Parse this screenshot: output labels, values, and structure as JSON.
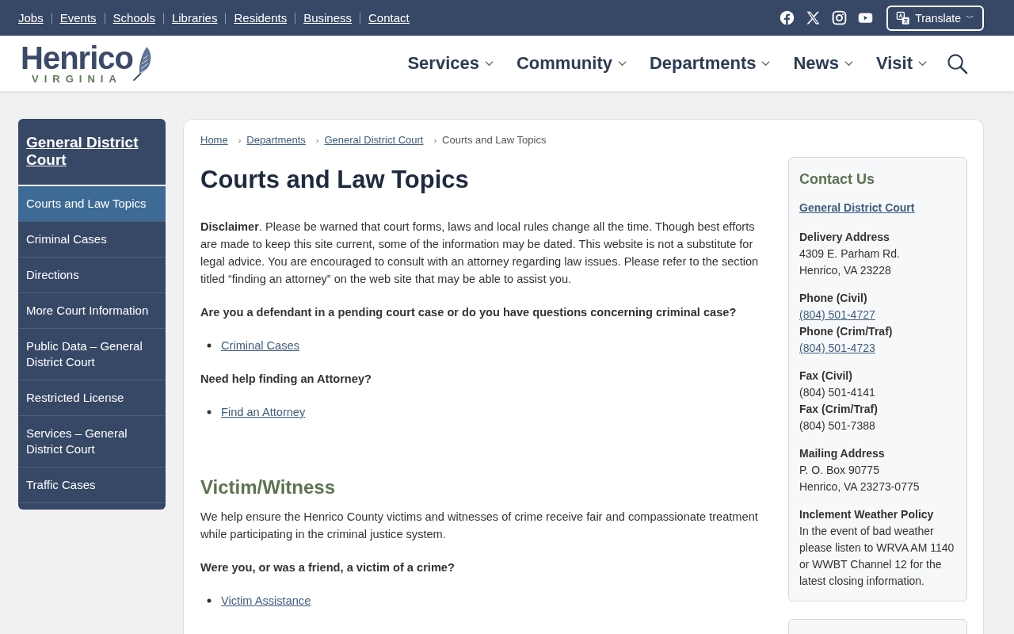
{
  "top_links": [
    "Jobs",
    "Events",
    "Schools",
    "Libraries",
    "Residents",
    "Business",
    "Contact"
  ],
  "social": [
    {
      "kind": "facebook"
    },
    {
      "kind": "x"
    },
    {
      "kind": "instagram"
    },
    {
      "kind": "youtube"
    }
  ],
  "translate": {
    "label": "Translate",
    "caret": "﹀"
  },
  "logo": {
    "name": "Henrico",
    "sub": "VIRGINIA"
  },
  "nav": [
    {
      "label": "Services"
    },
    {
      "label": "Community"
    },
    {
      "label": "Departments"
    },
    {
      "label": "News"
    },
    {
      "label": "Visit"
    }
  ],
  "sidebar": {
    "title": "General District Court",
    "items": [
      {
        "label": "Courts and Law Topics",
        "selected": true
      },
      {
        "label": "Criminal Cases",
        "selected": false
      },
      {
        "label": "Directions",
        "selected": false
      },
      {
        "label": "More Court Information",
        "selected": false
      },
      {
        "label": "Public Data – General District Court",
        "selected": false
      },
      {
        "label": "Restricted License",
        "selected": false
      },
      {
        "label": "Services – General District Court",
        "selected": false
      },
      {
        "label": "Traffic Cases",
        "selected": false
      }
    ]
  },
  "breadcrumb": [
    {
      "label": "Home",
      "link": true
    },
    {
      "label": "Departments",
      "link": true,
      "sep": "›"
    },
    {
      "label": "General District Court",
      "link": true,
      "sep": "›"
    },
    {
      "label": "Courts and Law Topics",
      "link": false,
      "sep": "›"
    }
  ],
  "title": "Courts and Law Topics",
  "content": [
    {
      "kind": "paragraph",
      "text": "**Disclaimer**. Please be warned that court forms, laws and local rules change all the time. Though best efforts are made to keep this site current, some of the information may be dated. This website is not a substitute for legal advice. You are encouraged to consult with an attorney regarding law issues. Please refer to the section titled “finding an attorney” on the web site that may be able to assist you."
    },
    {
      "kind": "question",
      "text": "Are you a defendant in a pending court case or do you have questions concerning criminal case?"
    },
    {
      "kind": "links",
      "items": [
        "Criminal Cases"
      ]
    },
    {
      "kind": "question",
      "text": "Need help finding an Attorney?"
    },
    {
      "kind": "links",
      "items": [
        "Find an Attorney"
      ]
    },
    {
      "kind": "heading",
      "text": "Victim/Witness"
    },
    {
      "kind": "paragraph",
      "text": "We help ensure the Henrico County victims and witnesses of crime receive fair and compassionate treatment while participating in the criminal justice system."
    },
    {
      "kind": "question",
      "text": "Were you, or was a friend, a victim of a crime?"
    },
    {
      "kind": "links",
      "items": [
        "Victim Assistance"
      ]
    }
  ],
  "contact": {
    "title": "Contact Us",
    "link": "General District Court",
    "groups": [
      {
        "rows": [
          {
            "label": "Delivery Address",
            "lines": [
              {
                "text": "4309 E. Parham Rd.",
                "link": false
              },
              {
                "text": "Henrico, VA 23228",
                "link": false
              }
            ]
          }
        ]
      },
      {
        "rows": [
          {
            "label": "Phone (Civil)",
            "lines": [
              {
                "text": "(804) 501-4727",
                "link": true
              }
            ]
          },
          {
            "label": "Phone (Crim/Traf)",
            "lines": [
              {
                "text": "(804) 501-4723",
                "link": true
              }
            ]
          }
        ]
      },
      {
        "rows": [
          {
            "label": "Fax (Civil)",
            "lines": [
              {
                "text": "(804) 501-4141",
                "link": false
              }
            ]
          },
          {
            "label": "Fax (Crim/Traf)",
            "lines": [
              {
                "text": "(804) 501-7388",
                "link": false
              }
            ]
          }
        ]
      },
      {
        "rows": [
          {
            "label": "Mailing Address",
            "lines": [
              {
                "text": "P. O. Box 90775",
                "link": false
              },
              {
                "text": "Henrico, VA 23273-0775",
                "link": false
              }
            ]
          }
        ]
      },
      {
        "rows": [
          {
            "label": "Inclement Weather Policy",
            "lines": [
              {
                "text": "In the event of bad weather please listen to WRVA AM 1140 or WWBT Channel 12 for the latest closing information.",
                "link": false
              }
            ]
          }
        ]
      }
    ]
  }
}
